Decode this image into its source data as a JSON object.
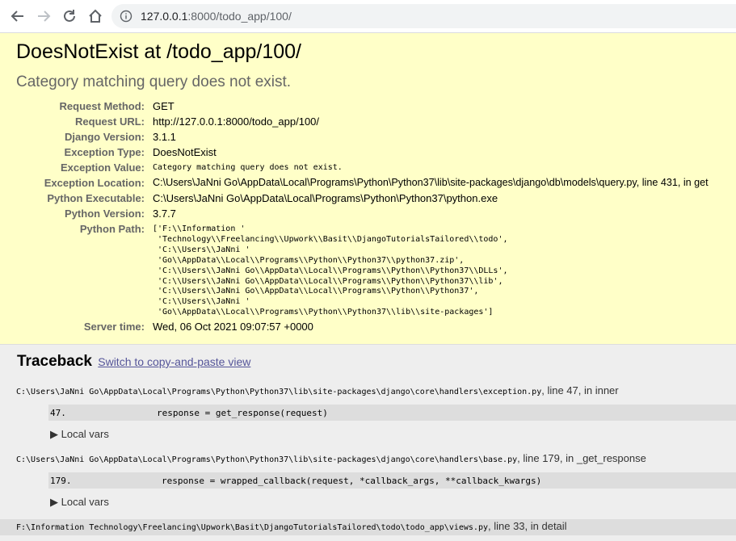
{
  "browser": {
    "url_host": "127.0.0.1",
    "url_rest": ":8000/todo_app/100/"
  },
  "summary": {
    "title": "DoesNotExist at /todo_app/100/",
    "subtitle": "Category matching query does not exist.",
    "meta": [
      {
        "label": "Request Method:",
        "value": "GET"
      },
      {
        "label": "Request URL:",
        "value": "http://127.0.0.1:8000/todo_app/100/"
      },
      {
        "label": "Django Version:",
        "value": "3.1.1"
      },
      {
        "label": "Exception Type:",
        "value": "DoesNotExist"
      },
      {
        "label": "Exception Value:",
        "value": "Category matching query does not exist."
      },
      {
        "label": "Exception Location:",
        "value": "C:\\Users\\JaNni Go\\AppData\\Local\\Programs\\Python\\Python37\\lib\\site-packages\\django\\db\\models\\query.py, line 431, in get"
      },
      {
        "label": "Python Executable:",
        "value": "C:\\Users\\JaNni Go\\AppData\\Local\\Programs\\Python\\Python37\\python.exe"
      },
      {
        "label": "Python Version:",
        "value": "3.7.7"
      },
      {
        "label": "Python Path:",
        "value": "['F:\\\\Information '\n 'Technology\\\\Freelancing\\\\Upwork\\\\Basit\\\\DjangoTutorialsTailored\\\\todo',\n 'C:\\\\Users\\\\JaNni '\n 'Go\\\\AppData\\\\Local\\\\Programs\\\\Python\\\\Python37\\\\python37.zip',\n 'C:\\\\Users\\\\JaNni Go\\\\AppData\\\\Local\\\\Programs\\\\Python\\\\Python37\\\\DLLs',\n 'C:\\\\Users\\\\JaNni Go\\\\AppData\\\\Local\\\\Programs\\\\Python\\\\Python37\\\\lib',\n 'C:\\\\Users\\\\JaNni Go\\\\AppData\\\\Local\\\\Programs\\\\Python\\\\Python37',\n 'C:\\\\Users\\\\JaNni '\n 'Go\\\\AppData\\\\Local\\\\Programs\\\\Python\\\\Python37\\\\lib\\\\site-packages']"
      },
      {
        "label": "Server time:",
        "value": "Wed, 06 Oct 2021 09:07:57 +0000"
      }
    ]
  },
  "traceback": {
    "title": "Traceback",
    "switch_link": "Switch to copy-and-paste view",
    "local_vars_label": "▶ Local vars",
    "frames": [
      {
        "file": "C:\\Users\\JaNni Go\\AppData\\Local\\Programs\\Python\\Python37\\lib\\site-packages\\django\\core\\handlers\\exception.py",
        "where": ", line 47, in inner",
        "lineno": "47.",
        "code": "response = get_response(request)"
      },
      {
        "file": "C:\\Users\\JaNni Go\\AppData\\Local\\Programs\\Python\\Python37\\lib\\site-packages\\django\\core\\handlers\\base.py",
        "where": ", line 179, in _get_response",
        "lineno": "179.",
        "code": "response = wrapped_callback(request, *callback_args, **callback_kwargs)"
      },
      {
        "file": "F:\\Information Technology\\Freelancing\\Upwork\\Basit\\DjangoTutorialsTailored\\todo\\todo_app\\views.py",
        "where": ", line 33, in detail"
      }
    ]
  }
}
